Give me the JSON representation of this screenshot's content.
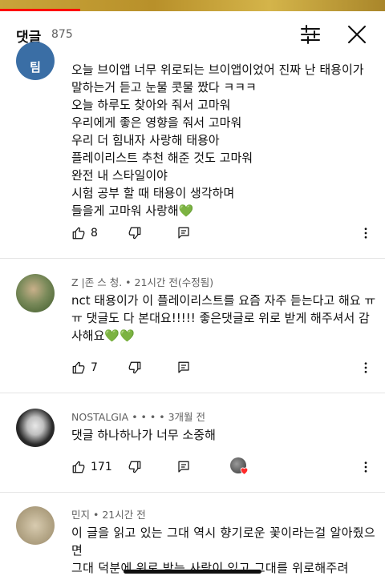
{
  "header": {
    "title": "댓글",
    "count": "875"
  },
  "comments": [
    {
      "avatar_letter": "팀",
      "avatar_color": "#3a6ea5",
      "body": "오늘 브이앱 너무 위로되는 브이앱이었어 진짜 난 태용이가 말하는거 듣고 눈물 콧물 짰다 ㅋㅋㅋ\n오늘 하루도 찾아와 줘서 고마워\n우리에게 좋은 영향을 줘서 고마워\n우리 더 힘내자 사랑해 태용아\n플레이리스트 추천 해준 것도 고마워\n완전 내 스타일이야\n시험 공부 할 때 태용이 생각하며\n들을게 고마워 사랑해💚",
      "likes": "8"
    },
    {
      "author": "Z |존 스 청.",
      "time": "21시간 전(수정됨)",
      "body": "nct 태용이가 이 플레이리스트를 요즘 자주 듣는다고 해요 ㅠㅠ 댓글도 다 본대요!!!!! 좋은댓글로 위로 받게 해주셔서 감사해요💚💚",
      "likes": "7"
    },
    {
      "author": "NOSTALGIA • • •",
      "time": "3개월 전",
      "body": "댓글 하나하나가 너무 소중해",
      "likes": "171"
    },
    {
      "author": "민지",
      "time": "21시간 전",
      "body": "이 글을 읽고 있는 그대 역시 향기로운 꽃이라는걸 알아줬으면\n그대 덕분에 위로 받는 사람이 있고 그대를 위로해주려"
    }
  ],
  "sep": " • ",
  "icons": [
    "filter-icon",
    "close-icon",
    "thumb-up-icon",
    "thumb-down-icon",
    "reply-icon",
    "more-icon",
    "heart-icon"
  ]
}
